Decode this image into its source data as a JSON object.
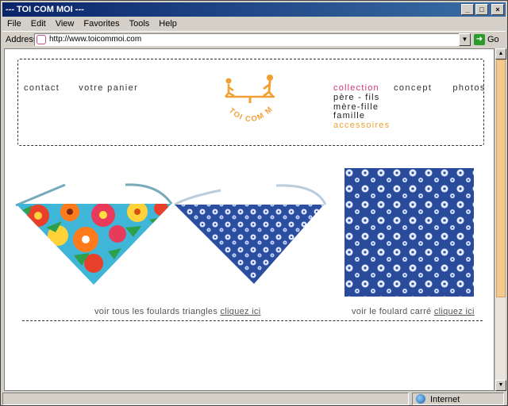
{
  "window": {
    "title": "--- TOI COM MOI ---"
  },
  "menu": [
    "File",
    "Edit",
    "View",
    "Favorites",
    "Tools",
    "Help"
  ],
  "address": {
    "label": "Address",
    "url": "http://www.toicommoi.com",
    "go_label": "Go"
  },
  "status": {
    "zone": "Internet"
  },
  "nav": {
    "left": [
      "contact",
      "votre panier"
    ],
    "collection": "collection",
    "right": [
      "concept",
      "photos"
    ],
    "submenu": [
      "père - fils",
      "mère-fille",
      "famille",
      "accessoires"
    ]
  },
  "logo_text": "TOI COM MOI",
  "captions": {
    "triangles": "voir tous les foulards triangles",
    "triangles_link": "cliquez ici",
    "square": "voir le foulard carré",
    "square_link": "cliquez ici"
  },
  "colors": {
    "accent_pink": "#d0357a",
    "accent_orange": "#f0a033",
    "logo_orange": "#f0a033"
  }
}
